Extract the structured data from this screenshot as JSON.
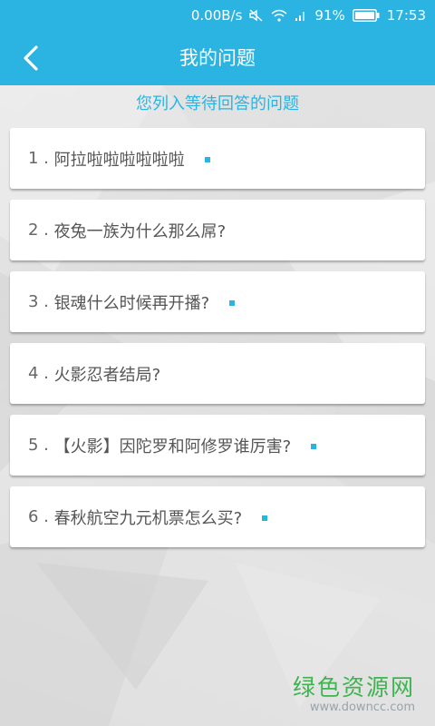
{
  "status_bar": {
    "speed": "0.00B/s",
    "battery": "91%",
    "time": "17:53"
  },
  "header": {
    "title": "我的问题",
    "back_icon": "chevron-left-icon"
  },
  "subtitle": "您列入等待回答的问题",
  "questions": [
    {
      "number": "1 .",
      "text": "阿拉啦啦啦啦啦啦",
      "marked": true
    },
    {
      "number": "2 .",
      "text": "夜兔一族为什么那么屌?",
      "marked": false
    },
    {
      "number": "3 .",
      "text": "银魂什么时候再开播?",
      "marked": true
    },
    {
      "number": "4 .",
      "text": "火影忍者结局?",
      "marked": false
    },
    {
      "number": "5 .",
      "text": "【火影】因陀罗和阿修罗谁厉害?",
      "marked": true
    },
    {
      "number": "6 .",
      "text": "春秋航空九元机票怎么买?",
      "marked": true
    }
  ],
  "watermark": {
    "name": "绿色资源网",
    "url": "www.downcc.com"
  },
  "colors": {
    "accent": "#2bb3e2",
    "watermark_green": "#3fb34f"
  }
}
